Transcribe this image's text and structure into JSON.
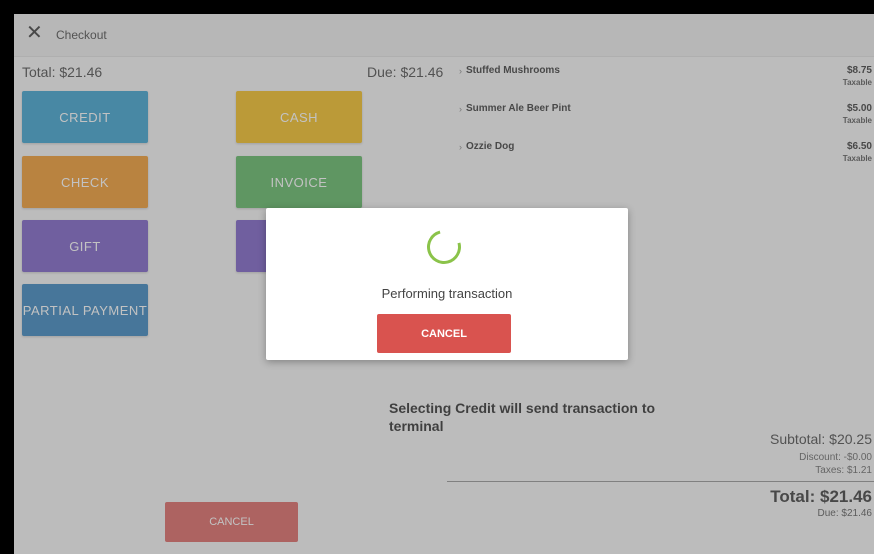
{
  "header": {
    "close_icon": "close-icon",
    "title": "Checkout"
  },
  "summary": {
    "total": "Total: $21.46",
    "due": "Due: $21.46"
  },
  "payment_methods": [
    {
      "label": "CREDIT",
      "color": "#2196c9"
    },
    {
      "label": "CASH",
      "color": "#f2b705"
    },
    {
      "label": "CHECK",
      "color": "#ef8c13"
    },
    {
      "label": "INVOICE",
      "color": "#4caf50"
    },
    {
      "label": "GIFT",
      "color": "#6a4bc0"
    },
    {
      "label": "",
      "color": "#6a4bc0"
    },
    {
      "label": "PARTIAL PAYMENT",
      "color": "#1f75b6"
    }
  ],
  "items": [
    {
      "name": "Stuffed Mushrooms",
      "price": "$8.75",
      "tax": "Taxable"
    },
    {
      "name": "Summer Ale Beer Pint",
      "price": "$5.00",
      "tax": "Taxable"
    },
    {
      "name": "Ozzie Dog",
      "price": "$6.50",
      "tax": "Taxable"
    }
  ],
  "notice": "Selecting Credit will send transaction to terminal",
  "totals": {
    "subtotal": "Subtotal: $20.25",
    "discount": "Discount: -$0.00",
    "taxes": "Taxes: $1.21",
    "total": "Total: $21.46",
    "due": "Due: $21.46"
  },
  "cancel_label": "CANCEL",
  "modal": {
    "message": "Performing transaction",
    "cancel_label": "CANCEL",
    "spinner_color": "#8bc34a"
  }
}
